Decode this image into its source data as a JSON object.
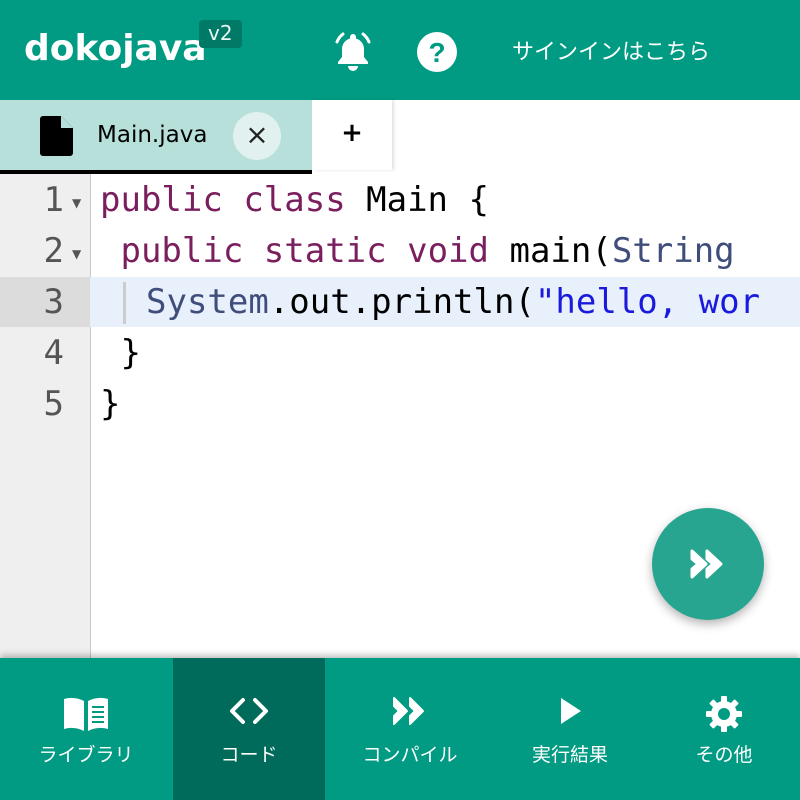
{
  "header": {
    "logo": "dokojava",
    "version": "v2",
    "bell_icon": "bell-icon",
    "help_icon": "question-icon",
    "signin": "サインインはこちら"
  },
  "tabs": {
    "active": {
      "label": "Main.java",
      "icon": "file-icon",
      "close": "×"
    },
    "add_label": "+"
  },
  "editor": {
    "line_numbers": [
      "1",
      "2",
      "3",
      "4",
      "5"
    ],
    "current_line": 3,
    "lines": [
      {
        "kw1": "public",
        "sp1": " ",
        "kw2": "class",
        "rest": " Main {"
      },
      {
        "pre": " ",
        "kw1": "public",
        "sp1": " ",
        "kw2": "static",
        "sp2": " ",
        "kw3": "void",
        "rest": " main(",
        "ty": "String"
      },
      {
        "ty": "System",
        "rest": ".out.println(",
        "str": "\"hello, wor"
      },
      {
        "rest": " }"
      },
      {
        "rest": "}"
      }
    ]
  },
  "run_button": {
    "icon": "run-icon"
  },
  "bottom_nav": [
    {
      "label": "ライブラリ",
      "icon": "book-icon"
    },
    {
      "label": "コード",
      "icon": "code-icon"
    },
    {
      "label": "コンパイル",
      "icon": "compile-icon"
    },
    {
      "label": "実行結果",
      "icon": "play-icon"
    },
    {
      "label": "その他",
      "icon": "gear-icon"
    }
  ],
  "colors": {
    "brand": "#009b82",
    "brand_dark": "#006b5a",
    "tab_active": "#b7e0db",
    "fab": "#27a591"
  }
}
